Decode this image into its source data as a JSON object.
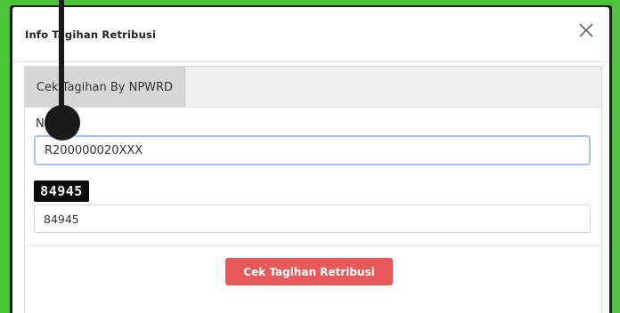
{
  "modal": {
    "title": "Info Tagihan Retribusi",
    "close_icon": "close-icon"
  },
  "tabs": [
    {
      "label": "Cek Tagihan By NPWRD",
      "active": true
    }
  ],
  "form": {
    "npwrd_label": "NPWRD",
    "npwrd_value": "R200000020XXX",
    "captcha_text": "84945",
    "captcha_value": "84945",
    "submit_label": "Cek Tagihan Retribusi"
  },
  "colors": {
    "background": "#4cc43a",
    "submit_button": "#e85a5a",
    "input_focus_border": "#a8c4ee",
    "active_tab": "#d7d7d7"
  }
}
